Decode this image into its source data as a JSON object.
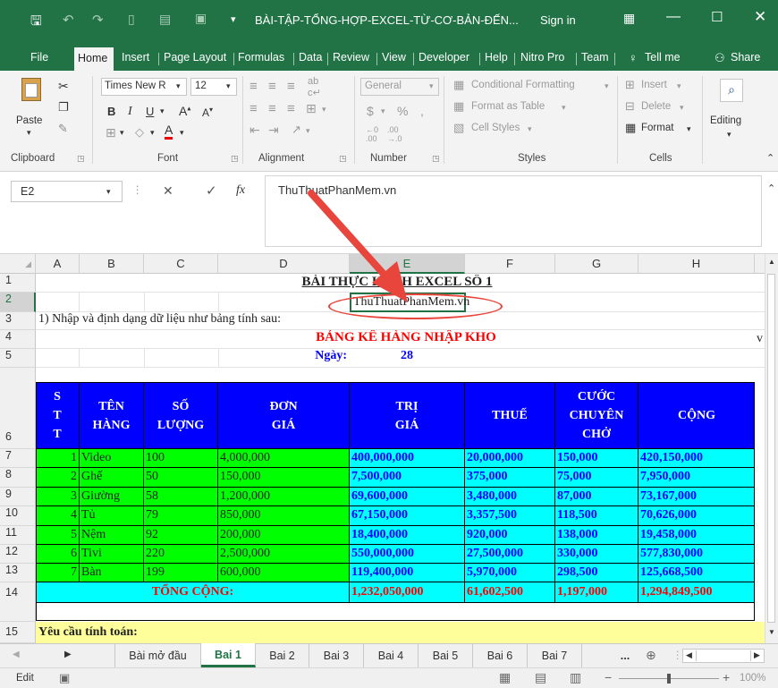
{
  "window": {
    "title": "BÀI-TẬP-TỔNG-HỢP-EXCEL-TỪ-CƠ-BẢN-ĐẾN...",
    "sign_in": "Sign in",
    "accent": "#217346"
  },
  "tabs": [
    "File",
    "Home",
    "Insert",
    "Page Layout",
    "Formulas",
    "Data",
    "Review",
    "View",
    "Developer",
    "Help",
    "Nitro Pro",
    "Team"
  ],
  "tell_me": "Tell me",
  "share": "Share",
  "ribbon": {
    "paste": "Paste",
    "font_name": "Times New R",
    "font_size": "12",
    "number_format": "General",
    "conditional_formatting": "Conditional Formatting",
    "format_as_table": "Format as Table",
    "cell_styles": "Cell Styles",
    "insert": "Insert",
    "delete": "Delete",
    "format": "Format",
    "editing": "Editing",
    "groups": [
      "Clipboard",
      "Font",
      "Alignment",
      "Number",
      "Styles",
      "Cells"
    ]
  },
  "formula_bar": {
    "name_box": "E2",
    "fx": "fx",
    "value": "ThuThuatPhanMem.vn"
  },
  "columns": [
    "A",
    "B",
    "C",
    "D",
    "E",
    "F",
    "G",
    "H"
  ],
  "rows": [
    "1",
    "2",
    "3",
    "4",
    "5",
    "6",
    "7",
    "8",
    "9",
    "10",
    "11",
    "12",
    "13",
    "14",
    "15"
  ],
  "sheet": {
    "title": "BÀI THỰC HÀNH EXCEL SỐ 1",
    "e2": "ThuThuatPhanMem.vn",
    "instruction": "1) Nhập và định dạng dữ liệu như bảng tính sau:",
    "table_title": "BẢNG KÊ HÀNG NHẬP KHO",
    "date_label": "Ngày:",
    "date_value": "28",
    "overflow_char": "v",
    "headers": {
      "stt": [
        "S",
        "T",
        "T"
      ],
      "ten_hang": [
        "TÊN",
        "HÀNG"
      ],
      "so_luong": [
        "SỐ",
        "LƯỢNG"
      ],
      "don_gia": [
        "ĐƠN",
        "GIÁ"
      ],
      "tri_gia": [
        "TRỊ",
        "GIÁ"
      ],
      "thue": [
        "THUẾ"
      ],
      "cuoc": [
        "CƯỚC",
        "CHUYÊN",
        "CHỞ"
      ],
      "cong": [
        "CỘNG"
      ]
    },
    "items": [
      {
        "stt": "1",
        "name": "Video",
        "qty": "100",
        "price": "4,000,000",
        "value": "400,000,000",
        "tax": "20,000,000",
        "freight": "150,000",
        "total": "420,150,000"
      },
      {
        "stt": "2",
        "name": "Ghế",
        "qty": "50",
        "price": "150,000",
        "value": "7,500,000",
        "tax": "375,000",
        "freight": "75,000",
        "total": "7,950,000"
      },
      {
        "stt": "3",
        "name": "Giường",
        "qty": "58",
        "price": "1,200,000",
        "value": "69,600,000",
        "tax": "3,480,000",
        "freight": "87,000",
        "total": "73,167,000"
      },
      {
        "stt": "4",
        "name": "Tủ",
        "qty": "79",
        "price": "850,000",
        "value": "67,150,000",
        "tax": "3,357,500",
        "freight": "118,500",
        "total": "70,626,000"
      },
      {
        "stt": "5",
        "name": "Nệm",
        "qty": "92",
        "price": "200,000",
        "value": "18,400,000",
        "tax": "920,000",
        "freight": "138,000",
        "total": "19,458,000"
      },
      {
        "stt": "6",
        "name": "Tivi",
        "qty": "220",
        "price": "2,500,000",
        "value": "550,000,000",
        "tax": "27,500,000",
        "freight": "330,000",
        "total": "577,830,000"
      },
      {
        "stt": "7",
        "name": "Bàn",
        "qty": "199",
        "price": "600,000",
        "value": "119,400,000",
        "tax": "5,970,000",
        "freight": "298,500",
        "total": "125,668,500"
      }
    ],
    "total_label": "TỔNG CỘNG:",
    "totals": {
      "value": "1,232,050,000",
      "tax": "61,602,500",
      "freight": "1,197,000",
      "total": "1,294,849,500"
    },
    "requirement": "Yêu cầu tính toán:"
  },
  "sheet_tabs": [
    "Bài mở đầu",
    "Bai 1",
    "Bai 2",
    "Bai 3",
    "Bai 4",
    "Bai 5",
    "Bai 6",
    "Bai 7",
    "..."
  ],
  "status": {
    "mode": "Edit",
    "zoom": "100%"
  }
}
